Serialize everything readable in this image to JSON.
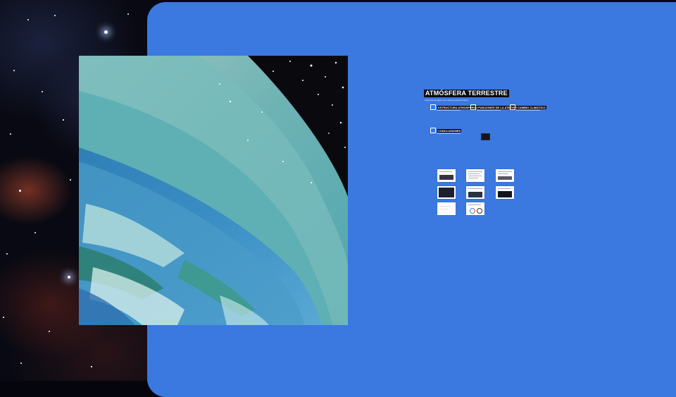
{
  "presentation": {
    "title": "ATMÓSFERA TERRESTRE",
    "subtitle": "capa fina de gases que rodea el planeta Tierra",
    "topics": [
      {
        "label": "ESTRUCTURA ATMOSFÉRICA",
        "icon": "layers-icon"
      },
      {
        "label": "FUNCIONES DE LA ATMÓSFERA",
        "icon": "shield-icon"
      },
      {
        "label": "CAMBIO CLIMÁTICO",
        "icon": "thermometer-icon"
      },
      {
        "label": "CONCLUSIONES",
        "icon": "note-icon"
      }
    ],
    "thumbnails_count": 8
  },
  "colors": {
    "panel_blue": "#3b78df",
    "space": "#080912"
  }
}
